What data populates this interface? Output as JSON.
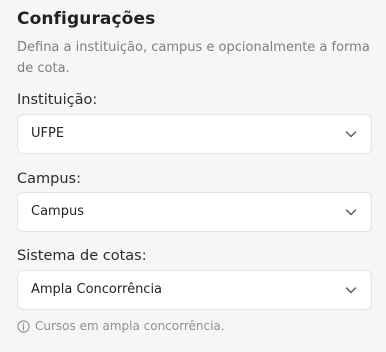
{
  "settings": {
    "title": "Configurações",
    "description": "Defina a instituição, campus e opcionalmente a forma de cota."
  },
  "fields": {
    "institution": {
      "label": "Instituição:",
      "value": "UFPE"
    },
    "campus": {
      "label": "Campus:",
      "value": "Campus"
    },
    "quota": {
      "label": "Sistema de cotas:",
      "value": "Ampla Concorrência"
    }
  },
  "hint": {
    "text": "Cursos em ampla concorrência.",
    "icon": "info-icon"
  },
  "icons": {
    "select_chevron": "chevron-down-icon"
  }
}
